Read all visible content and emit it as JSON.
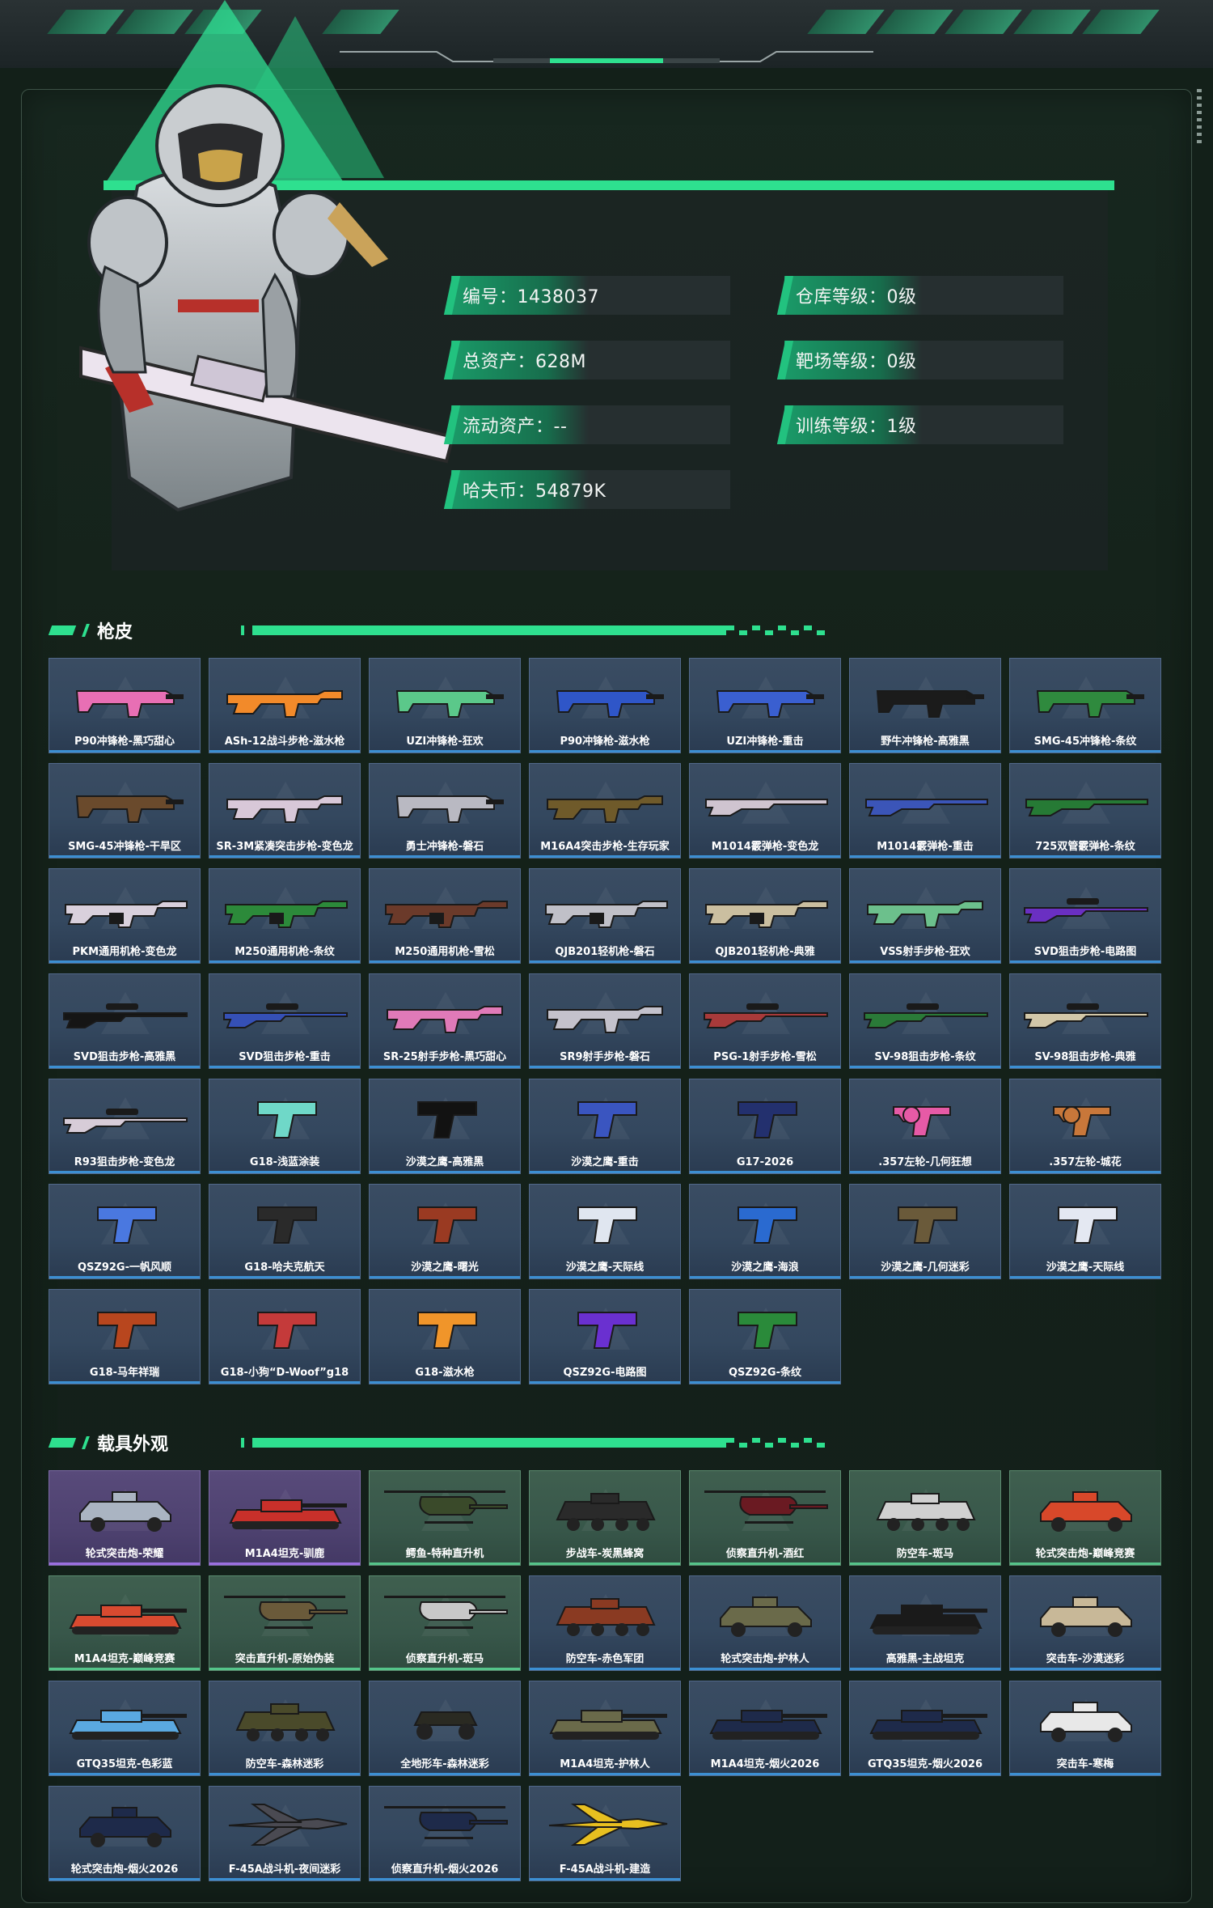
{
  "profile": {
    "stats_left": [
      {
        "label": "编号：1438037"
      },
      {
        "label": "总资产：628M"
      },
      {
        "label": "流动资产：--"
      },
      {
        "label": "哈夫币：54879K"
      }
    ],
    "stats_right": [
      {
        "label": "仓库等级：0级"
      },
      {
        "label": "靶场等级：0级"
      },
      {
        "label": "训练等级：1级"
      }
    ]
  },
  "sections": {
    "gun_skins_title": "枪皮",
    "vehicle_skins_title": "载具外观"
  },
  "gun_skins": [
    {
      "name": "P90冲锋枪-黑巧甜心",
      "icon": "smg-icon",
      "color": "#e86fb4"
    },
    {
      "name": "ASh-12战斗步枪-滋水枪",
      "icon": "rifle-icon",
      "color": "#f28a2a"
    },
    {
      "name": "UZI冲锋枪-狂欢",
      "icon": "smg-icon",
      "color": "#5bc88a"
    },
    {
      "name": "P90冲锋枪-滋水枪",
      "icon": "smg-icon",
      "color": "#2f56c8"
    },
    {
      "name": "UZI冲锋枪-重击",
      "icon": "smg-icon",
      "color": "#3a5fd0"
    },
    {
      "name": "野牛冲锋枪-高雅黑",
      "icon": "smg-icon",
      "color": "#1b1b1b"
    },
    {
      "name": "SMG-45冲锋枪-条纹",
      "icon": "smg-icon",
      "color": "#2f8a3e"
    },
    {
      "name": "SMG-45冲锋枪-干旱区",
      "icon": "smg-icon",
      "color": "#6a4a2c"
    },
    {
      "name": "SR-3M紧凑突击步枪-变色龙",
      "icon": "rifle-icon",
      "color": "#d8c8d8"
    },
    {
      "name": "勇士冲锋枪-磐石",
      "icon": "smg-icon",
      "color": "#b9b9c2"
    },
    {
      "name": "M16A4突击步枪-生存玩家",
      "icon": "rifle-icon",
      "color": "#6f5a2a"
    },
    {
      "name": "M1014霰弹枪-变色龙",
      "icon": "shotgun-icon",
      "color": "#cfc4d0"
    },
    {
      "name": "M1014霰弹枪-重击",
      "icon": "shotgun-icon",
      "color": "#3b55b8"
    },
    {
      "name": "725双管霰弹枪-条纹",
      "icon": "shotgun-icon",
      "color": "#267a35"
    },
    {
      "name": "PKM通用机枪-变色龙",
      "icon": "mg-icon",
      "color": "#d9d0dc"
    },
    {
      "name": "M250通用机枪-条纹",
      "icon": "mg-icon",
      "color": "#2c8a3a"
    },
    {
      "name": "M250通用机枪-雪松",
      "icon": "mg-icon",
      "color": "#6b3a2a"
    },
    {
      "name": "QJB201轻机枪-磐石",
      "icon": "mg-icon",
      "color": "#c0c0c8"
    },
    {
      "name": "QJB201轻机枪-典雅",
      "icon": "mg-icon",
      "color": "#cbbfa0"
    },
    {
      "name": "VSS射手步枪-狂欢",
      "icon": "rifle-icon",
      "color": "#6cc08c"
    },
    {
      "name": "SVD狙击步枪-电路图",
      "icon": "sniper-icon",
      "color": "#6a2fc2"
    },
    {
      "name": "SVD狙击步枪-高雅黑",
      "icon": "sniper-icon",
      "color": "#151515"
    },
    {
      "name": "SVD狙击步枪-重击",
      "icon": "sniper-icon",
      "color": "#3550b6"
    },
    {
      "name": "SR-25射手步枪-黑巧甜心",
      "icon": "rifle-icon",
      "color": "#e07ab8"
    },
    {
      "name": "SR9射手步枪-磐石",
      "icon": "rifle-icon",
      "color": "#c4c2cc"
    },
    {
      "name": "PSG-1射手步枪-雪松",
      "icon": "sniper-icon",
      "color": "#a83a3a"
    },
    {
      "name": "SV-98狙击步枪-条纹",
      "icon": "sniper-icon",
      "color": "#2a7a38"
    },
    {
      "name": "SV-98狙击步枪-典雅",
      "icon": "sniper-icon",
      "color": "#d2c7a8"
    },
    {
      "name": "R93狙击步枪-变色龙",
      "icon": "sniper-icon",
      "color": "#d7ccd8"
    },
    {
      "name": "G18-浅蓝涂装",
      "icon": "pistol-icon",
      "color": "#6fd8c8"
    },
    {
      "name": "沙漠之鹰-高雅黑",
      "icon": "pistol-icon",
      "color": "#121212"
    },
    {
      "name": "沙漠之鹰-重击",
      "icon": "pistol-icon",
      "color": "#3a55c0"
    },
    {
      "name": "G17-2026",
      "icon": "pistol-icon",
      "color": "#23306e"
    },
    {
      "name": ".357左轮-几何狂想",
      "icon": "revolver-icon",
      "color": "#e65aa6"
    },
    {
      "name": ".357左轮-城花",
      "icon": "revolver-icon",
      "color": "#c8773a"
    },
    {
      "name": "QSZ92G-一帆风顺",
      "icon": "pistol-icon",
      "color": "#4a78e0"
    },
    {
      "name": "G18-哈夫克航天",
      "icon": "pistol-icon",
      "color": "#2a2a2a"
    },
    {
      "name": "沙漠之鹰-曙光",
      "icon": "pistol-icon",
      "color": "#9a3a22"
    },
    {
      "name": "沙漠之鹰-天际线",
      "icon": "pistol-icon",
      "color": "#e0e6f0"
    },
    {
      "name": "沙漠之鹰-海浪",
      "icon": "pistol-icon",
      "color": "#2a6ad0"
    },
    {
      "name": "沙漠之鹰-几何迷彩",
      "icon": "pistol-icon",
      "color": "#6a5a3a"
    },
    {
      "name": "沙漠之鹰-天际线",
      "icon": "pistol-icon",
      "color": "#e4e8f2"
    },
    {
      "name": "G18-马年祥瑞",
      "icon": "pistol-icon",
      "color": "#b8461e"
    },
    {
      "name": "G18-小狗“D-Woof”g18",
      "icon": "pistol-icon",
      "color": "#c43a3a"
    },
    {
      "name": "G18-滋水枪",
      "icon": "pistol-icon",
      "color": "#f0952a"
    },
    {
      "name": "QSZ92G-电路图",
      "icon": "pistol-icon",
      "color": "#6a30d0"
    },
    {
      "name": "QSZ92G-条纹",
      "icon": "pistol-icon",
      "color": "#2a8a3a"
    }
  ],
  "vehicle_skins": [
    {
      "name": "轮式突击炮-荣耀",
      "icon": "armored-car-icon",
      "color": "#aab4c2",
      "rarity": "purple"
    },
    {
      "name": "M1A4坦克-驯鹿",
      "icon": "tank-icon",
      "color": "#c8302a",
      "rarity": "purple"
    },
    {
      "name": "鳄鱼-特种直升机",
      "icon": "helicopter-icon",
      "color": "#3a4a2a",
      "rarity": "green"
    },
    {
      "name": "步战车-炭黑蜂窝",
      "icon": "apc-icon",
      "color": "#2a2a2a",
      "rarity": "green"
    },
    {
      "name": "侦察直升机-酒红",
      "icon": "helicopter-icon",
      "color": "#6a1a22",
      "rarity": "green"
    },
    {
      "name": "防空车-斑马",
      "icon": "apc-icon",
      "color": "#d0d0d0",
      "rarity": "green"
    },
    {
      "name": "轮式突击炮-巅峰竞赛",
      "icon": "armored-car-icon",
      "color": "#d8482a",
      "rarity": "green"
    },
    {
      "name": "M1A4坦克-巅峰竞赛",
      "icon": "tank-icon",
      "color": "#d84a30",
      "rarity": "green"
    },
    {
      "name": "突击直升机-原始伪装",
      "icon": "helicopter-icon",
      "color": "#6a5a3a",
      "rarity": "green"
    },
    {
      "name": "侦察直升机-斑马",
      "icon": "helicopter-icon",
      "color": "#c8c8c8",
      "rarity": "green"
    },
    {
      "name": "防空车-赤色军团",
      "icon": "apc-icon",
      "color": "#8a3a22",
      "rarity": "blue"
    },
    {
      "name": "轮式突击炮-护林人",
      "icon": "armored-car-icon",
      "color": "#6a6a4a",
      "rarity": "blue"
    },
    {
      "name": "高雅黑-主战坦克",
      "icon": "tank-icon",
      "color": "#1a1a1a",
      "rarity": "blue"
    },
    {
      "name": "突击车-沙漠迷彩",
      "icon": "armored-car-icon",
      "color": "#c8b898",
      "rarity": "blue"
    },
    {
      "name": "GTQ35坦克-色彩蓝",
      "icon": "tank-icon",
      "color": "#5aa8e0",
      "rarity": "blue"
    },
    {
      "name": "防空车-森林迷彩",
      "icon": "apc-icon",
      "color": "#4a4a2a",
      "rarity": "blue"
    },
    {
      "name": "全地形车-森林迷彩",
      "icon": "atv-icon",
      "color": "#2a2a22",
      "rarity": "blue"
    },
    {
      "name": "M1A4坦克-护林人",
      "icon": "tank-icon",
      "color": "#6a6a4a",
      "rarity": "blue"
    },
    {
      "name": "M1A4坦克-烟火2026",
      "icon": "tank-icon",
      "color": "#1e2a4a",
      "rarity": "blue"
    },
    {
      "name": "GTQ35坦克-烟火2026",
      "icon": "tank-icon",
      "color": "#1e2a4a",
      "rarity": "blue"
    },
    {
      "name": "突击车-寒梅",
      "icon": "armored-car-icon",
      "color": "#e8e8e8",
      "rarity": "blue"
    },
    {
      "name": "轮式突击炮-烟火2026",
      "icon": "armored-car-icon",
      "color": "#1e2a4a",
      "rarity": "blue"
    },
    {
      "name": "F-45A战斗机-夜间迷彩",
      "icon": "jet-icon",
      "color": "#4a4a52",
      "rarity": "blue"
    },
    {
      "name": "侦察直升机-烟火2026",
      "icon": "helicopter-icon",
      "color": "#1e2a4a",
      "rarity": "blue"
    },
    {
      "name": "F-45A战斗机-建造",
      "icon": "jet-icon",
      "color": "#e8c020",
      "rarity": "blue"
    }
  ]
}
